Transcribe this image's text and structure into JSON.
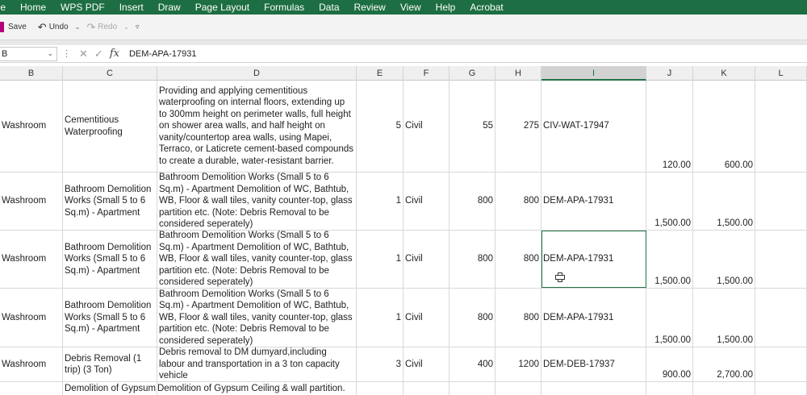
{
  "menu": [
    "ile",
    "Home",
    "WPS PDF",
    "Insert",
    "Draw",
    "Page Layout",
    "Formulas",
    "Data",
    "Review",
    "View",
    "Help",
    "Acrobat"
  ],
  "qat": {
    "save": "Save",
    "undo": "Undo",
    "redo": "Redo"
  },
  "formula_bar": {
    "name_box": "B",
    "content": "DEM-APA-17931"
  },
  "columns": [
    "B",
    "C",
    "D",
    "E",
    "F",
    "G",
    "H",
    "I",
    "J",
    "K",
    "L"
  ],
  "active_column": "I",
  "rows": [
    {
      "b": "Washroom",
      "c": "Cementitious Waterproofing",
      "d": "Providing and applying cementitious waterproofing on internal floors, extending up to 300mm height on perimeter walls, full height on shower area walls, and half height on vanity/countertop area walls, using Mapei, Terraco, or Laticrete cement-based compounds to create a durable, water-resistant barrier.",
      "e": "5",
      "f": "Civil",
      "g": "55",
      "h": "275",
      "i": "CIV-WAT-17947",
      "j": "120.00",
      "k": "600.00"
    },
    {
      "b": "Washroom",
      "c": "Bathroom Demolition Works (Small 5 to 6 Sq.m) - Apartment",
      "d": "Bathroom Demolition Works (Small 5 to 6 Sq.m) - Apartment Demolition of WC, Bathtub, WB, Floor & wall tiles, vanity counter-top, glass partition etc. (Note: Debris Removal to be considered seperately)",
      "e": "1",
      "f": "Civil",
      "g": "800",
      "h": "800",
      "i": "DEM-APA-17931",
      "j": "1,500.00",
      "k": "1,500.00"
    },
    {
      "b": "Washroom",
      "c": "Bathroom Demolition Works (Small 5 to 6 Sq.m) - Apartment",
      "d": "Bathroom Demolition Works (Small 5 to 6 Sq.m) - Apartment Demolition of WC, Bathtub, WB, Floor & wall tiles, vanity counter-top, glass partition etc. (Note: Debris Removal to be considered seperately)",
      "e": "1",
      "f": "Civil",
      "g": "800",
      "h": "800",
      "i": "DEM-APA-17931",
      "j": "1,500.00",
      "k": "1,500.00"
    },
    {
      "b": "Washroom",
      "c": "Bathroom Demolition Works (Small 5 to 6 Sq.m) - Apartment",
      "d": "Bathroom Demolition Works (Small 5 to 6 Sq.m) - Apartment Demolition of WC, Bathtub, WB, Floor & wall tiles, vanity counter-top, glass partition etc. (Note: Debris Removal to be considered seperately)",
      "e": "1",
      "f": "Civil",
      "g": "800",
      "h": "800",
      "i": "DEM-APA-17931",
      "j": "1,500.00",
      "k": "1,500.00"
    },
    {
      "b": "Washroom",
      "c": "Debris Removal (1 trip) (3 Ton)",
      "d": "Debris removal to DM dumyard,including labour and transportation in a 3 ton capacity vehicle",
      "e": "3",
      "f": "Civil",
      "g": "400",
      "h": "1200",
      "i": "DEM-DEB-17937",
      "j": "900.00",
      "k": "2,700.00"
    },
    {
      "b": "",
      "c": "Demolition of Gypsum",
      "d": "Demolition of Gypsum Ceiling & wall partition.",
      "e": "",
      "f": "",
      "g": "",
      "h": "",
      "i": "",
      "j": "",
      "k": ""
    }
  ]
}
